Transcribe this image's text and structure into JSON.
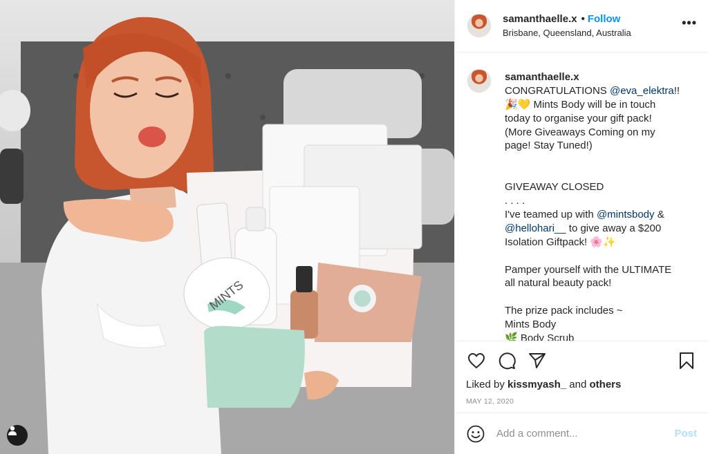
{
  "header": {
    "username": "samanthaelle.x",
    "separator": "•",
    "follow_label": "Follow",
    "location": "Brisbane, Queensland, Australia",
    "more_icon": "more-options-icon"
  },
  "caption": {
    "username": "samanthaelle.x",
    "lines": [
      {
        "pre": "CONGRATULATIONS ",
        "mention": "@eva_elektra",
        "post": "!!"
      },
      {
        "pre": "🎉💛 Mints Body will be in touch",
        "mention": "",
        "post": ""
      },
      {
        "pre": "today to organise your gift pack!",
        "mention": "",
        "post": ""
      },
      {
        "pre": "(More Giveaways Coming on my",
        "mention": "",
        "post": ""
      },
      {
        "pre": "page! Stay Tuned!)",
        "mention": "",
        "post": ""
      },
      {
        "pre": "",
        "mention": "",
        "post": ""
      },
      {
        "pre": "",
        "mention": "",
        "post": ""
      },
      {
        "pre": "GIVEAWAY CLOSED",
        "mention": "",
        "post": ""
      },
      {
        "pre": ". . . .",
        "mention": "",
        "post": ""
      },
      {
        "pre": "I've teamed up with ",
        "mention": "@mintsbody",
        "post": " &"
      },
      {
        "pre": "",
        "mention": "@hellohari__",
        "post": " to give away a $200"
      },
      {
        "pre": "Isolation Giftpack! 🌸✨",
        "mention": "",
        "post": ""
      },
      {
        "pre": "",
        "mention": "",
        "post": ""
      },
      {
        "pre": "Pamper yourself with the ULTIMATE",
        "mention": "",
        "post": ""
      },
      {
        "pre": "all natural beauty pack!",
        "mention": "",
        "post": ""
      },
      {
        "pre": "",
        "mention": "",
        "post": ""
      },
      {
        "pre": "The prize pack includes ~",
        "mention": "",
        "post": ""
      },
      {
        "pre": "Mints Body",
        "mention": "",
        "post": ""
      },
      {
        "pre": "🌿 Body Scrub",
        "mention": "",
        "post": ""
      }
    ]
  },
  "actions": {
    "like_icon": "heart-icon",
    "comment_icon": "comment-icon",
    "share_icon": "share-icon",
    "save_icon": "bookmark-icon"
  },
  "likes": {
    "prefix": "Liked by ",
    "user": "kissmyash_",
    "middle": " and ",
    "others": "others"
  },
  "date": "MAY 12, 2020",
  "comment": {
    "placeholder": "Add a comment...",
    "post_label": "Post",
    "emoji_icon": "smiley-icon"
  },
  "photo": {
    "product_label": "MINTS",
    "tag_icon": "user-tag-icon"
  },
  "colors": {
    "link_blue": "#0095f6",
    "mention_blue": "#00376b",
    "post_disabled": "#b2dffc",
    "muted": "#8e8e8e"
  }
}
